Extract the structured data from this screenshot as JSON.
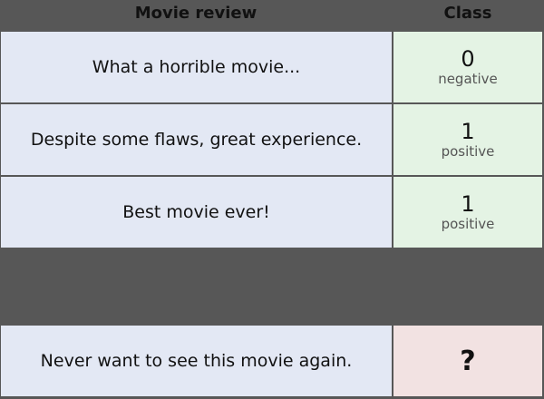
{
  "headers": {
    "review": "Movie review",
    "class": "Class"
  },
  "rows": [
    {
      "review": "What a horrible movie...",
      "class": "0",
      "label": "negative"
    },
    {
      "review": "Despite some flaws, great experience.",
      "class": "1",
      "label": "positive"
    },
    {
      "review": "Best movie ever!",
      "class": "1",
      "label": "positive"
    }
  ],
  "query": {
    "review": "Never want to see this movie again.",
    "class": "?"
  },
  "colors": {
    "background": "#575757",
    "review_cell": "#e3e8f4",
    "labeled_cell": "#e4f3e4",
    "unknown_cell": "#f2e2e2"
  }
}
